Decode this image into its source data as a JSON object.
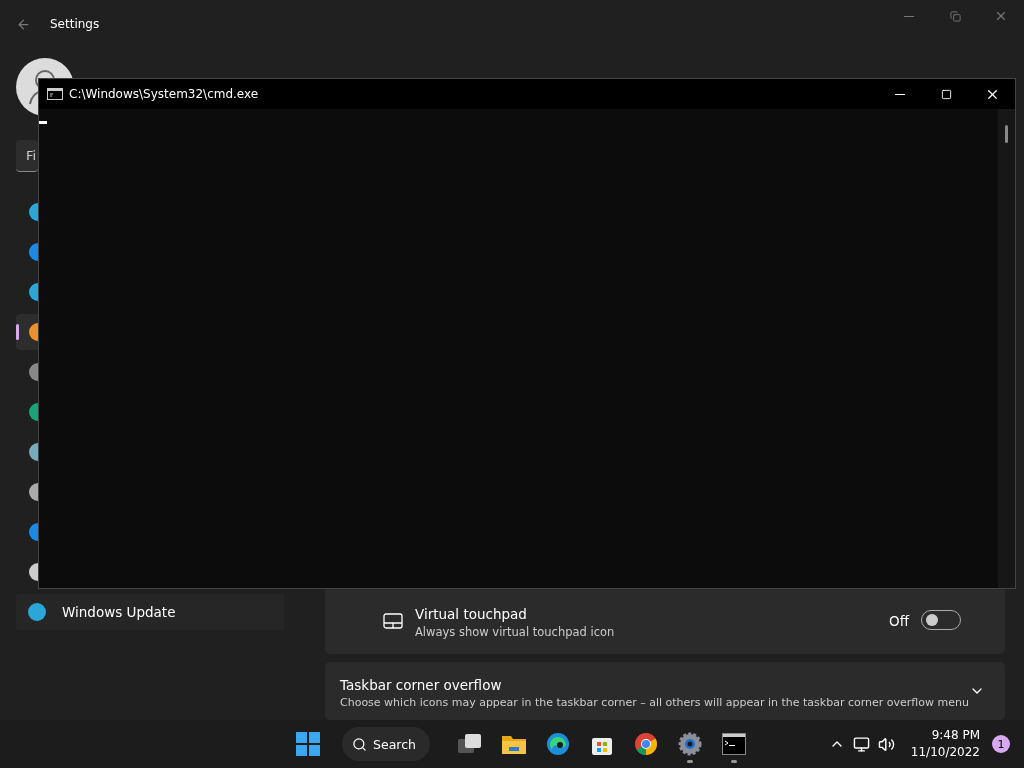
{
  "settings_window": {
    "title": "Settings",
    "search": {
      "placeholder": "Fi"
    },
    "nav_items": [
      {
        "selected": false
      },
      {
        "selected": false
      },
      {
        "selected": false
      },
      {
        "selected": true
      },
      {
        "selected": false
      },
      {
        "selected": false
      },
      {
        "selected": false
      },
      {
        "selected": false
      },
      {
        "selected": false
      },
      {
        "selected": false
      },
      {
        "selected": false,
        "label": "Windows Update"
      }
    ],
    "touchpad_setting": {
      "label": "Virtual touchpad",
      "description": "Always show virtual touchpad icon",
      "state_label": "Off",
      "on": false
    },
    "overflow_section": {
      "label": "Taskbar corner overflow",
      "description": "Choose which icons may appear in the taskbar corner – all others will appear in the taskbar corner overflow menu",
      "expanded": false
    }
  },
  "cmd_window": {
    "title": "C:\\Windows\\System32\\cmd.exe"
  },
  "taskbar": {
    "search": {
      "label": "Search"
    },
    "apps": [
      {
        "running": false
      },
      {
        "running": false
      },
      {
        "running": false
      },
      {
        "running": false
      },
      {
        "running": false
      },
      {
        "running": true
      },
      {
        "running": true
      }
    ],
    "clock": {
      "time": "9:48 PM",
      "date": "11/10/2022"
    },
    "notification_count": "1"
  }
}
